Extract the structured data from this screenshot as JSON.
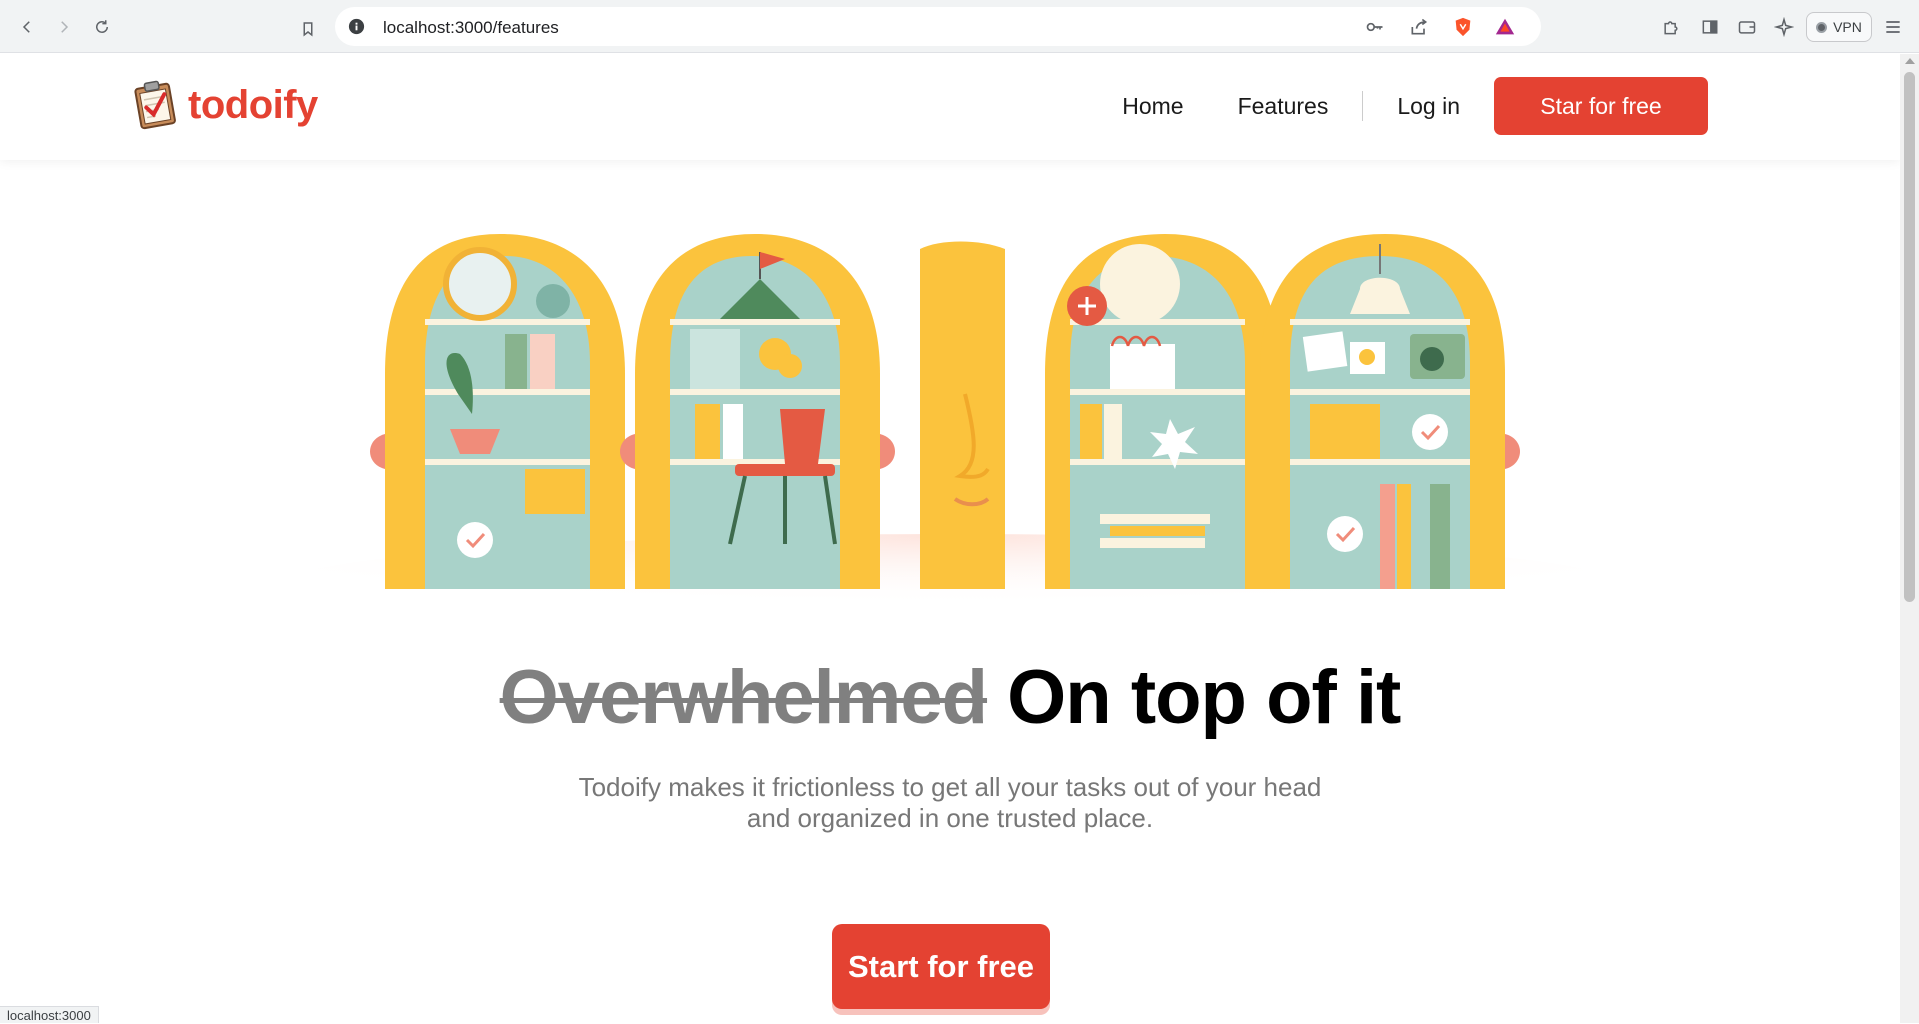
{
  "browser": {
    "url": "localhost:3000/features",
    "vpn_label": "VPN",
    "status_url": "localhost:3000"
  },
  "site": {
    "logo_text": "todoify",
    "nav": {
      "home": "Home",
      "features": "Features",
      "login": "Log in",
      "cta": "Star for free"
    },
    "hero": {
      "headline_struck": "Overwhelmed",
      "headline_main": "On top of it",
      "subtitle_line1": "Todoify makes it frictionless to get all your tasks out of your head",
      "subtitle_line2": "and organized in one trusted place.",
      "cta": "Start for free"
    }
  },
  "colors": {
    "brand_red": "#e44232",
    "chrome_bg": "#f1f3f4"
  }
}
